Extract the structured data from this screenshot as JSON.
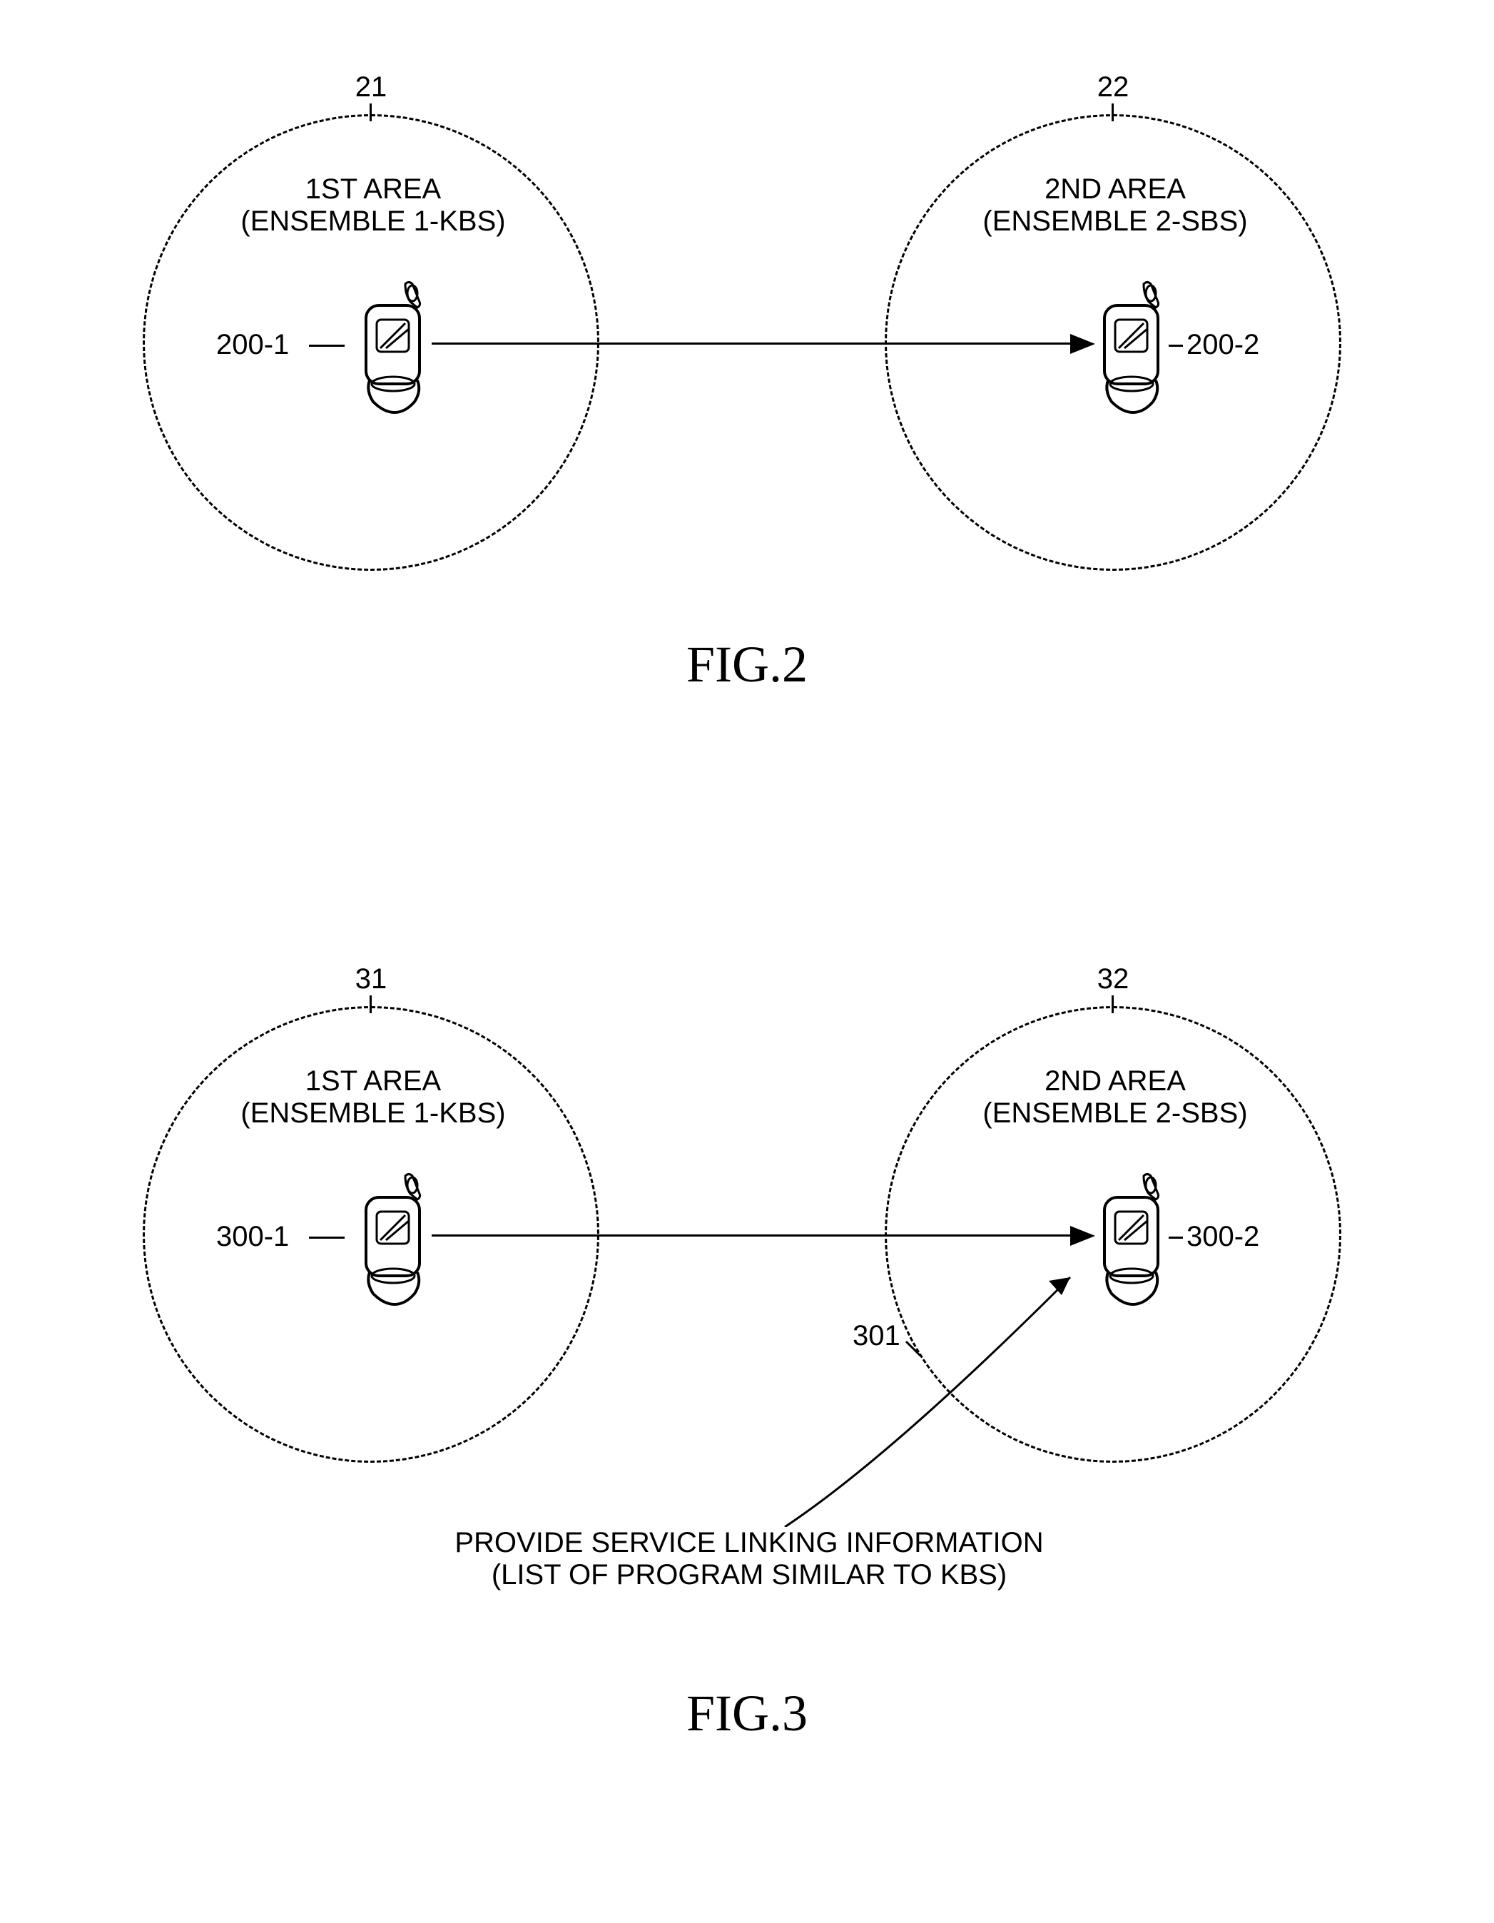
{
  "fig2": {
    "area1": {
      "topRef": "21",
      "line1": "1ST AREA",
      "line2": "(ENSEMBLE 1-KBS)",
      "phoneRef": "200-1"
    },
    "area2": {
      "topRef": "22",
      "line1": "2ND AREA",
      "line2": "(ENSEMBLE 2-SBS)",
      "phoneRef": "200-2"
    },
    "caption": "FIG.2"
  },
  "fig3": {
    "area1": {
      "topRef": "31",
      "line1": "1ST AREA",
      "line2": "(ENSEMBLE 1-KBS)",
      "phoneRef": "300-1"
    },
    "area2": {
      "topRef": "32",
      "line1": "2ND AREA",
      "line2": "(ENSEMBLE 2-SBS)",
      "phoneRef": "300-2"
    },
    "serviceRef": "301",
    "serviceLine1": "PROVIDE SERVICE LINKING INFORMATION",
    "serviceLine2": "(LIST OF PROGRAM SIMILAR TO KBS)",
    "caption": "FIG.3"
  }
}
